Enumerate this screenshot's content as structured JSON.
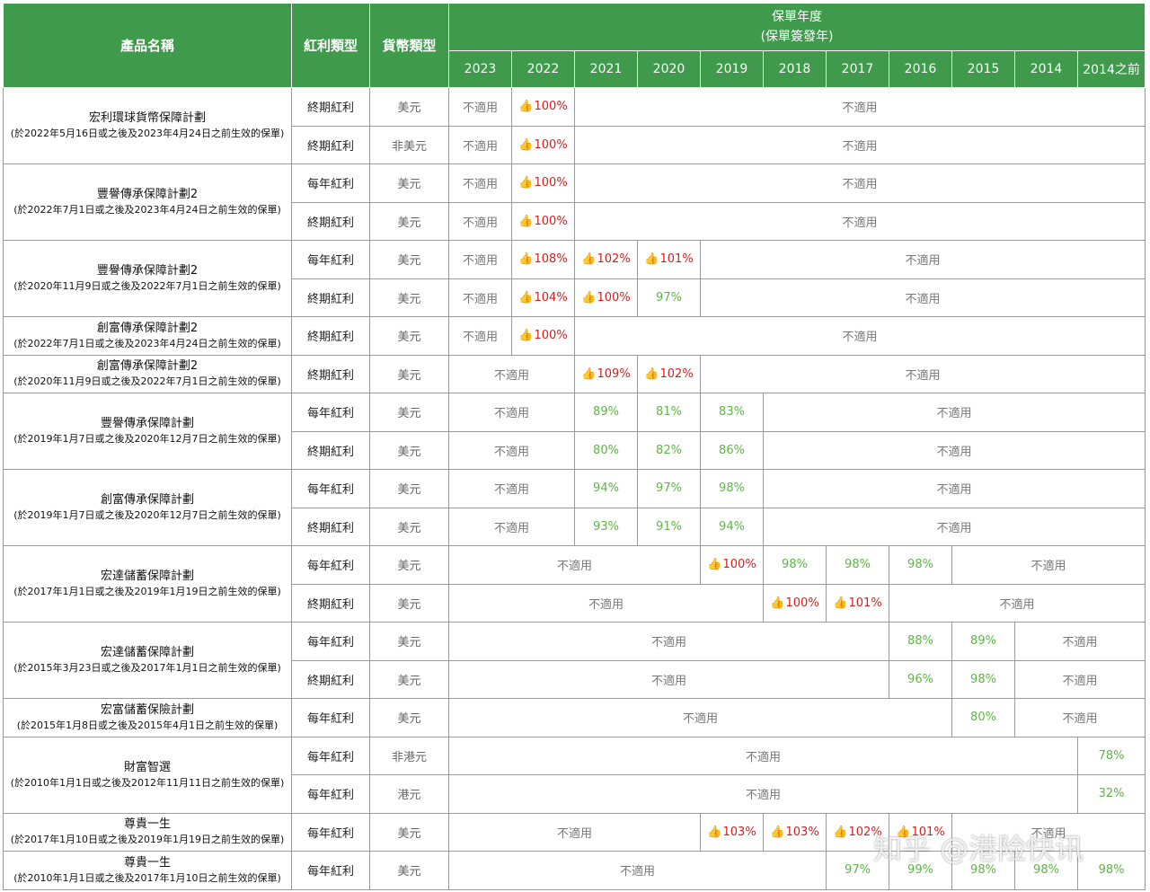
{
  "header": {
    "product_name": "產品名稱",
    "bonus_type": "紅利類型",
    "currency_type": "貨幣類型",
    "policy_year_line1": "保單年度",
    "policy_year_line2": "(保單簽發年)",
    "years": [
      "2023",
      "2022",
      "2021",
      "2020",
      "2019",
      "2018",
      "2017",
      "2016",
      "2015",
      "2014",
      "2014之前"
    ]
  },
  "na_text": "不適用",
  "rows": [
    {
      "product": "宏利環球貨幣保障計劃",
      "note": "(於2022年5月16日或之後及2023年4月24日之前生效的保單)",
      "bonus": "終期紅利",
      "currency": "美元",
      "cells": [
        {
          "t": "不適用",
          "s": 1
        },
        {
          "t": "100%",
          "s": 1,
          "c": "red",
          "thumb": true
        },
        {
          "t": "不適用",
          "s": 9
        }
      ]
    },
    {
      "bonus": "終期紅利",
      "currency": "非美元",
      "cells": [
        {
          "t": "不適用",
          "s": 1
        },
        {
          "t": "100%",
          "s": 1,
          "c": "red",
          "thumb": true
        },
        {
          "t": "不適用",
          "s": 9
        }
      ]
    },
    {
      "product": "豐譽傳承保障計劃2",
      "note": "(於2022年7月1日或之後及2023年4月24日之前生效的保單)",
      "bonus": "每年紅利",
      "currency": "美元",
      "cells": [
        {
          "t": "不適用",
          "s": 1
        },
        {
          "t": "100%",
          "s": 1,
          "c": "red",
          "thumb": true
        },
        {
          "t": "不適用",
          "s": 9
        }
      ]
    },
    {
      "bonus": "終期紅利",
      "currency": "美元",
      "cells": [
        {
          "t": "不適用",
          "s": 1
        },
        {
          "t": "100%",
          "s": 1,
          "c": "red",
          "thumb": true
        },
        {
          "t": "不適用",
          "s": 9
        }
      ]
    },
    {
      "product": "豐譽傳承保障計劃2",
      "note": "(於2020年11月9日或之後及2022年7月1日之前生效的保單)",
      "bonus": "每年紅利",
      "currency": "美元",
      "cells": [
        {
          "t": "不適用",
          "s": 1
        },
        {
          "t": "108%",
          "s": 1,
          "c": "red",
          "thumb": true
        },
        {
          "t": "102%",
          "s": 1,
          "c": "red",
          "thumb": true
        },
        {
          "t": "101%",
          "s": 1,
          "c": "red",
          "thumb": true
        },
        {
          "t": "不適用",
          "s": 7
        }
      ]
    },
    {
      "bonus": "終期紅利",
      "currency": "美元",
      "cells": [
        {
          "t": "不適用",
          "s": 1
        },
        {
          "t": "104%",
          "s": 1,
          "c": "red",
          "thumb": true
        },
        {
          "t": "100%",
          "s": 1,
          "c": "red",
          "thumb": true
        },
        {
          "t": "97%",
          "s": 1,
          "c": "green"
        },
        {
          "t": "不適用",
          "s": 7
        }
      ]
    },
    {
      "product": "創富傳承保障計劃2",
      "note": "(於2022年7月1日或之後及2023年4月24日之前生效的保單)",
      "bonus": "終期紅利",
      "currency": "美元",
      "cells": [
        {
          "t": "不適用",
          "s": 1
        },
        {
          "t": "100%",
          "s": 1,
          "c": "red",
          "thumb": true
        },
        {
          "t": "不適用",
          "s": 9
        }
      ]
    },
    {
      "product": "創富傳承保障計劃2",
      "note": "(於2020年11月9日或之後及2022年7月1日之前生效的保單)",
      "bonus": "終期紅利",
      "currency": "美元",
      "cells": [
        {
          "t": "不適用",
          "s": 2
        },
        {
          "t": "109%",
          "s": 1,
          "c": "red",
          "thumb": true
        },
        {
          "t": "102%",
          "s": 1,
          "c": "red",
          "thumb": true
        },
        {
          "t": "不適用",
          "s": 7
        }
      ]
    },
    {
      "product": "豐譽傳承保障計劃",
      "note": "(於2019年1月7日或之後及2020年12月7日之前生效的保單)",
      "bonus": "每年紅利",
      "currency": "美元",
      "cells": [
        {
          "t": "不適用",
          "s": 2
        },
        {
          "t": "89%",
          "s": 1,
          "c": "green"
        },
        {
          "t": "81%",
          "s": 1,
          "c": "green"
        },
        {
          "t": "83%",
          "s": 1,
          "c": "green"
        },
        {
          "t": "不適用",
          "s": 6
        }
      ]
    },
    {
      "bonus": "終期紅利",
      "currency": "美元",
      "cells": [
        {
          "t": "不適用",
          "s": 2
        },
        {
          "t": "80%",
          "s": 1,
          "c": "green"
        },
        {
          "t": "82%",
          "s": 1,
          "c": "green"
        },
        {
          "t": "86%",
          "s": 1,
          "c": "green"
        },
        {
          "t": "不適用",
          "s": 6
        }
      ]
    },
    {
      "product": "創富傳承保障計劃",
      "note": "(於2019年1月7日或之後及2020年12月7日之前生效的保單)",
      "bonus": "每年紅利",
      "currency": "美元",
      "cells": [
        {
          "t": "不適用",
          "s": 2
        },
        {
          "t": "94%",
          "s": 1,
          "c": "green"
        },
        {
          "t": "97%",
          "s": 1,
          "c": "green"
        },
        {
          "t": "98%",
          "s": 1,
          "c": "green"
        },
        {
          "t": "不適用",
          "s": 6
        }
      ]
    },
    {
      "bonus": "終期紅利",
      "currency": "美元",
      "cells": [
        {
          "t": "不適用",
          "s": 2
        },
        {
          "t": "93%",
          "s": 1,
          "c": "green"
        },
        {
          "t": "91%",
          "s": 1,
          "c": "green"
        },
        {
          "t": "94%",
          "s": 1,
          "c": "green"
        },
        {
          "t": "不適用",
          "s": 6
        }
      ]
    },
    {
      "product": "宏達儲蓄保障計劃",
      "note": "(於2017年1月1日或之後及2019年1月19日之前生效的保單)",
      "bonus": "每年紅利",
      "currency": "美元",
      "cells": [
        {
          "t": "不適用",
          "s": 4
        },
        {
          "t": "100%",
          "s": 1,
          "c": "red",
          "thumb": true
        },
        {
          "t": "98%",
          "s": 1,
          "c": "green"
        },
        {
          "t": "98%",
          "s": 1,
          "c": "green"
        },
        {
          "t": "98%",
          "s": 1,
          "c": "green"
        },
        {
          "t": "不適用",
          "s": 3
        }
      ]
    },
    {
      "bonus": "終期紅利",
      "currency": "美元",
      "cells": [
        {
          "t": "不適用",
          "s": 5
        },
        {
          "t": "100%",
          "s": 1,
          "c": "red",
          "thumb": true
        },
        {
          "t": "101%",
          "s": 1,
          "c": "red",
          "thumb": true
        },
        {
          "t": "不適用",
          "s": 4
        }
      ]
    },
    {
      "product": "宏達儲蓄保障計劃",
      "note": "(於2015年3月23日或之後及2017年1月1日之前生效的保單)",
      "bonus": "每年紅利",
      "currency": "美元",
      "cells": [
        {
          "t": "不適用",
          "s": 7
        },
        {
          "t": "88%",
          "s": 1,
          "c": "green"
        },
        {
          "t": "89%",
          "s": 1,
          "c": "green"
        },
        {
          "t": "不適用",
          "s": 2
        }
      ]
    },
    {
      "bonus": "終期紅利",
      "currency": "美元",
      "cells": [
        {
          "t": "不適用",
          "s": 7
        },
        {
          "t": "96%",
          "s": 1,
          "c": "green"
        },
        {
          "t": "98%",
          "s": 1,
          "c": "green"
        },
        {
          "t": "不適用",
          "s": 2
        }
      ]
    },
    {
      "product": "宏富儲蓄保險計劃",
      "note": "(於2015年1月8日或之後及2015年4月1日之前生效的保單)",
      "bonus": "每年紅利",
      "currency": "美元",
      "cells": [
        {
          "t": "不適用",
          "s": 8
        },
        {
          "t": "80%",
          "s": 1,
          "c": "green"
        },
        {
          "t": "不適用",
          "s": 2
        }
      ]
    },
    {
      "product": "財富智選",
      "note": "(於2010年1月1日或之後及2012年11月11日之前生效的保單)",
      "bonus": "每年紅利",
      "currency": "非港元",
      "cells": [
        {
          "t": "不適用",
          "s": 10
        },
        {
          "t": "78%",
          "s": 1,
          "c": "green"
        }
      ]
    },
    {
      "bonus": "每年紅利",
      "currency": "港元",
      "cells": [
        {
          "t": "不適用",
          "s": 10
        },
        {
          "t": "32%",
          "s": 1,
          "c": "green"
        }
      ]
    },
    {
      "product": "尊貴一生",
      "note": "(於2017年1月10日或之後及2019年1月19日之前生效的保單)",
      "bonus": "每年紅利",
      "currency": "美元",
      "cells": [
        {
          "t": "不適用",
          "s": 4
        },
        {
          "t": "103%",
          "s": 1,
          "c": "red",
          "thumb": true
        },
        {
          "t": "103%",
          "s": 1,
          "c": "red",
          "thumb": true
        },
        {
          "t": "102%",
          "s": 1,
          "c": "red",
          "thumb": true
        },
        {
          "t": "101%",
          "s": 1,
          "c": "red",
          "thumb": true
        },
        {
          "t": "不適用",
          "s": 3
        }
      ]
    },
    {
      "product": "尊貴一生",
      "note": "(於2010年1月1日或之後及2017年1月10日之前生效的保單)",
      "bonus": "每年紅利",
      "currency": "美元",
      "cells": [
        {
          "t": "不適用",
          "s": 6
        },
        {
          "t": "97%",
          "s": 1,
          "c": "green"
        },
        {
          "t": "99%",
          "s": 1,
          "c": "green"
        },
        {
          "t": "98%",
          "s": 1,
          "c": "green"
        },
        {
          "t": "98%",
          "s": 1,
          "c": "green"
        },
        {
          "t": "98%",
          "s": 1,
          "c": "green"
        }
      ]
    }
  ],
  "product_spans": [
    2,
    0,
    2,
    0,
    2,
    0,
    1,
    1,
    2,
    0,
    2,
    0,
    2,
    0,
    2,
    0,
    1,
    2,
    0,
    1,
    1
  ],
  "thumb_icon": "thumbs-up-icon",
  "colors": {
    "header_green": "#3f9b4b",
    "value_green": "#5fb547",
    "value_red": "#d71e1e"
  },
  "watermark": "知乎 @港险快讯"
}
